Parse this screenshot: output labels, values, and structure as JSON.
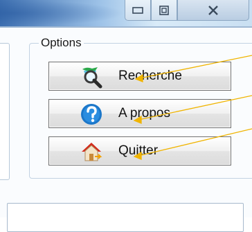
{
  "window": {
    "minimize_icon": "minimize-icon",
    "restore_icon": "restore-icon",
    "close_icon": "close-icon"
  },
  "options": {
    "legend": "Options",
    "buttons": [
      {
        "label": "Recherche",
        "icon": "search-icon"
      },
      {
        "label": "A propos",
        "icon": "help-icon"
      },
      {
        "label": "Quitter",
        "icon": "home-exit-icon"
      }
    ]
  },
  "colors": {
    "titlebar_accent": "#3d6fb0",
    "annotation_arrow": "#f0b400",
    "help_icon_blue": "#1c77c9",
    "home_roof_red": "#d22b1c"
  }
}
